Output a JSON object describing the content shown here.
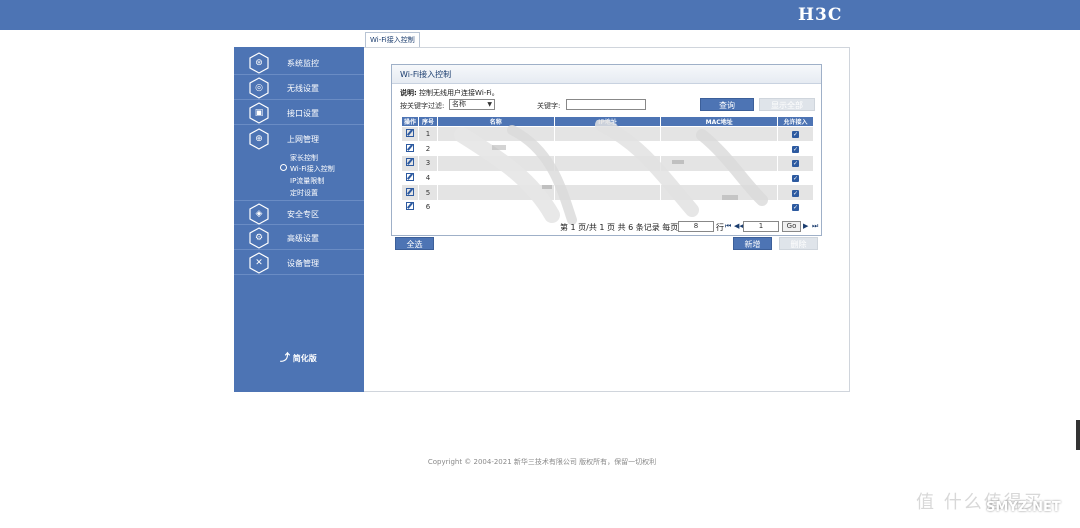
{
  "brand": {
    "logo": "H3C"
  },
  "tab": {
    "label": "Wi-Fi接入控制"
  },
  "sidebar": {
    "items": [
      {
        "label": "系统监控",
        "icon": "monitor-icon",
        "glyph": "⊛"
      },
      {
        "label": "无线设置",
        "icon": "wireless-icon",
        "glyph": "◎"
      },
      {
        "label": "接口设置",
        "icon": "interface-icon",
        "glyph": "▣"
      },
      {
        "label": "上网管理",
        "icon": "globe-icon",
        "glyph": "⊕"
      },
      {
        "label": "安全专区",
        "icon": "shield-icon",
        "glyph": "◈"
      },
      {
        "label": "高级设置",
        "icon": "gear-icon",
        "glyph": "⚙"
      },
      {
        "label": "设备管理",
        "icon": "tools-icon",
        "glyph": "✕"
      }
    ],
    "subitems": [
      "家长控制",
      "Wi-Fi接入控制",
      "IP流量限制",
      "定时设置"
    ],
    "simple_mode": "简化版"
  },
  "panel": {
    "title": "Wi-Fi接入控制",
    "desc_label": "说明:",
    "desc_text": "控制无线用户连接Wi-Fi。",
    "filter_label": "按关键字过滤:",
    "filter_value": "名称",
    "keyword_label": "关键字:",
    "search_button": "查询",
    "show_all_button": "显示全部",
    "columns": [
      "操作",
      "序号",
      "名称",
      "IP地址",
      "MAC地址",
      "允许接入"
    ],
    "rows": [
      {
        "index": "1",
        "allowed": true
      },
      {
        "index": "2",
        "allowed": true
      },
      {
        "index": "3",
        "allowed": true
      },
      {
        "index": "4",
        "allowed": true
      },
      {
        "index": "5",
        "allowed": true
      },
      {
        "index": "6",
        "allowed": true
      }
    ],
    "pager": {
      "text": "第 1 页/共 1 页 共 6 条记录 每页",
      "per_page": "8",
      "rows_unit": "行",
      "page": "1",
      "go": "Go"
    },
    "select_all_button": "全选",
    "add_button": "新增",
    "delete_button": "删除"
  },
  "footer": {
    "copyright": "Copyright © 2004-2021 新华三技术有限公司 版权所有，保留一切权利"
  },
  "watermark": {
    "text": "值 什么值得买",
    "brand": "SMYZ.NET"
  },
  "colors": {
    "primary": "#4d74b4",
    "row_alt": "#e4e4e4",
    "checkbox": "#2d5aa0"
  }
}
